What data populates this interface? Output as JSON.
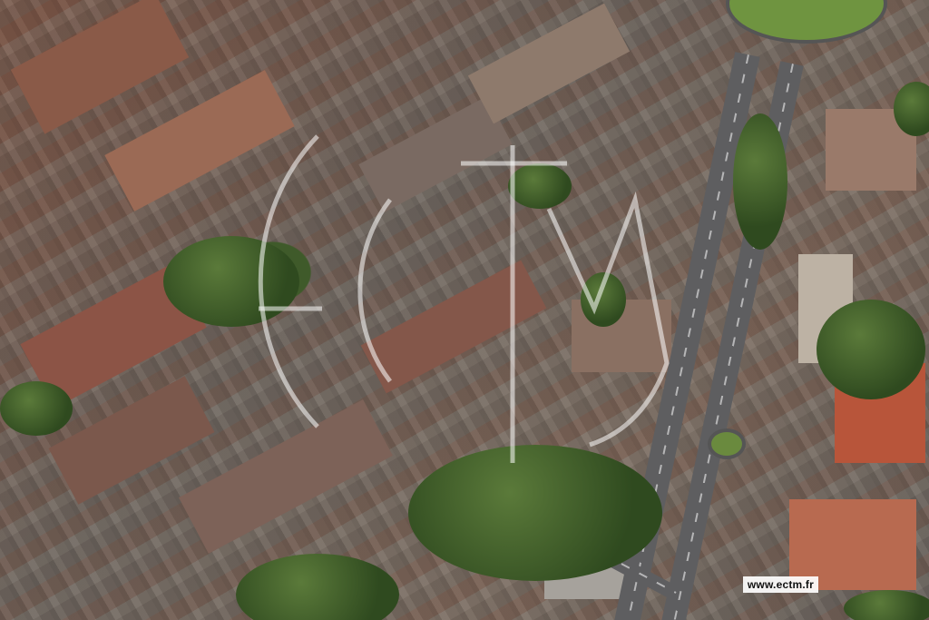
{
  "image": {
    "description_kind": "aerial-city-photo",
    "credit_text": "www.ectm.fr",
    "watermark": "ECTM"
  }
}
